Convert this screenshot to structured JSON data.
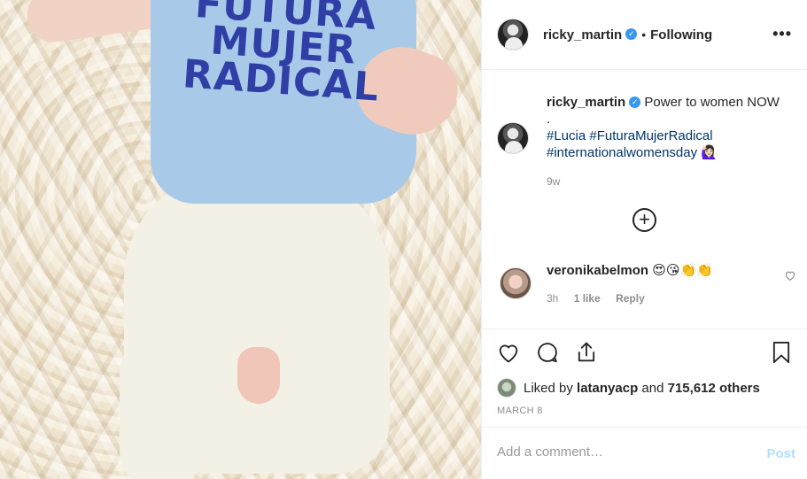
{
  "photo": {
    "shirt_text": "FUTURA MUJER RADICAL"
  },
  "header": {
    "username": "ricky_martin",
    "verified_icon": "verified-badge-icon",
    "separator": "•",
    "follow_status": "Following",
    "more_icon": "more-options-icon"
  },
  "caption": {
    "username": "ricky_martin",
    "text": "Power to women NOW",
    "dot": ".",
    "hashtags": [
      "#Lucia",
      "#FuturaMujerRadical",
      "#internationalwomensday"
    ],
    "emoji": "🙋🏻‍♀️",
    "time": "9w"
  },
  "load_more_icon": "plus-circle-icon",
  "comments": [
    {
      "username": "veronikabelmon",
      "text": "😍😘👏👏",
      "time": "3h",
      "likes": "1 like",
      "reply": "Reply"
    }
  ],
  "actions": {
    "like_icon": "heart-icon",
    "comment_icon": "comment-icon",
    "share_icon": "share-icon",
    "save_icon": "bookmark-icon"
  },
  "likes": {
    "prefix": "Liked by",
    "user": "latanyacp",
    "joiner": "and",
    "others": "715,612 others"
  },
  "date": "MARCH 8",
  "comment_box": {
    "placeholder": "Add a comment…",
    "post_label": "Post"
  },
  "colors": {
    "link": "#003569",
    "verified": "#3897f0",
    "post_disabled": "#b2dffc",
    "muted": "#8e8e8e"
  }
}
